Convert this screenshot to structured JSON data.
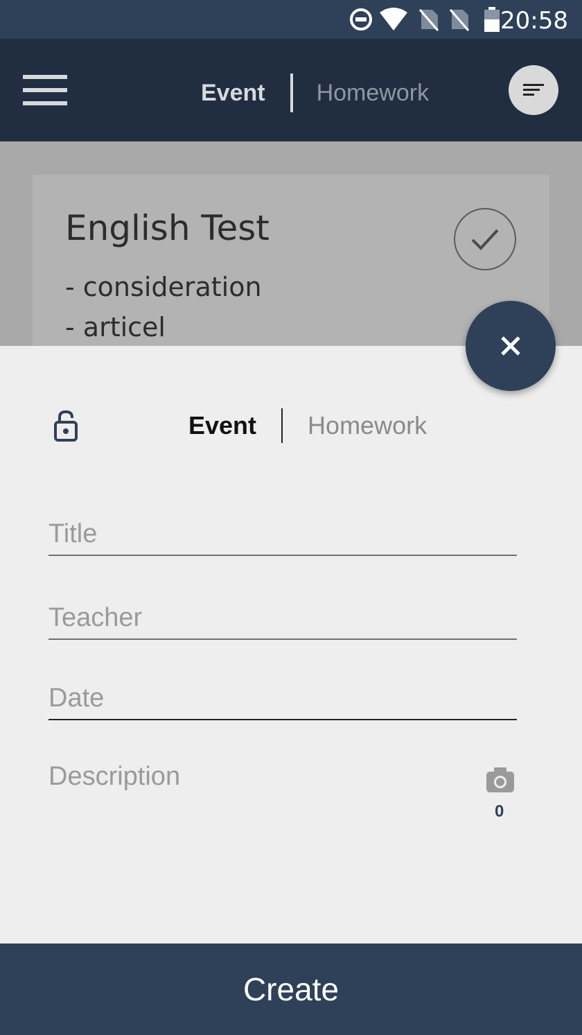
{
  "status_bar": {
    "time": "20:58"
  },
  "header": {
    "tab_event": "Event",
    "tab_homework": "Homework"
  },
  "card": {
    "title": "English Test",
    "lines": [
      "- consideration",
      "- articel"
    ]
  },
  "sheet": {
    "tab_event": "Event",
    "tab_homework": "Homework",
    "fields": {
      "title_placeholder": "Title",
      "teacher_placeholder": "Teacher",
      "date_placeholder": "Date",
      "description_placeholder": "Description"
    },
    "photo_count": "0"
  },
  "create_label": "Create",
  "colors": {
    "primary": "#2f4059",
    "header": "#212d40",
    "sheet_bg": "#eeeeee"
  }
}
